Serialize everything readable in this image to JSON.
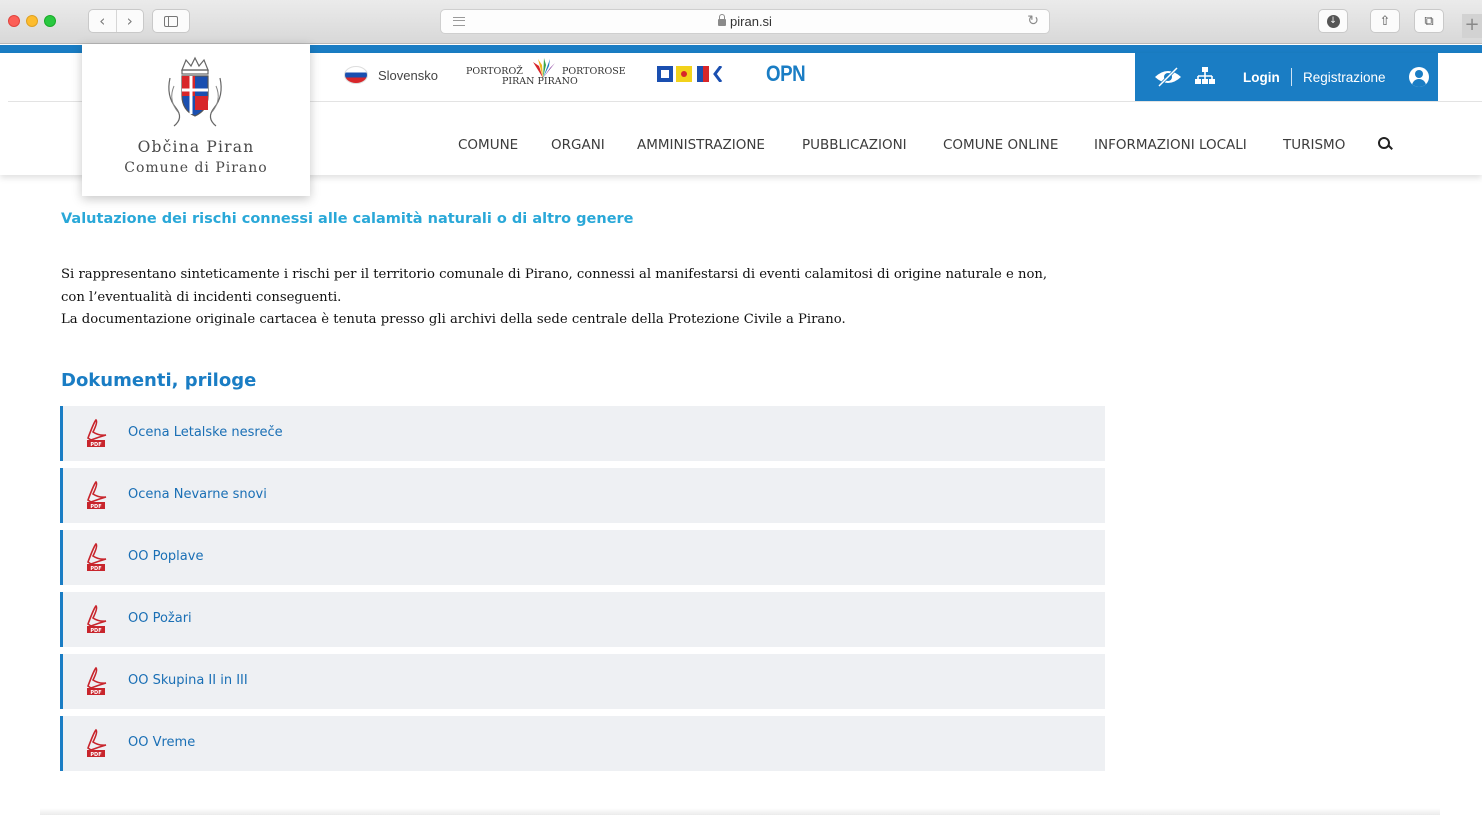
{
  "browser": {
    "url": "piran.si",
    "reader_icon": "reader-icon",
    "lock_icon": "lock-icon",
    "reload_icon": "reload-icon",
    "back_glyph": "‹",
    "forward_glyph": "›",
    "reload_glyph": "↻",
    "download_glyph": "↓",
    "share_glyph": "⇧",
    "tabs_glyph": "⧉",
    "newtab_glyph": "+"
  },
  "logo": {
    "line1": "Občina Piran",
    "line2": "Comune di Pirano"
  },
  "topbar": {
    "language": "Slovensko",
    "portoroz": {
      "left": "PORTOROŽ",
      "right": "PORTOROSE",
      "bottom": "PIRAN PIRANO"
    },
    "opn": "OPN",
    "login": "Login",
    "register": "Registrazione"
  },
  "nav": {
    "items": [
      "COMUNE",
      "ORGANI",
      "AMMINISTRAZIONE",
      "PUBBLICAZIONI",
      "COMUNE ONLINE",
      "INFORMAZIONI LOCALI",
      "TURISMO"
    ]
  },
  "content": {
    "title": "Valutazione dei rischi connessi alle calamità naturali o di altro genere",
    "intro": [
      "Si rappresentano sinteticamente i rischi per il territorio comunale di Pirano, connessi al manifestarsi di eventi calamitosi di origine naturale e non,",
      "con l’eventualità di incidenti conseguenti.",
      "La documentazione originale cartacea è tenuta presso gli archivi della sede centrale della Protezione Civile a Pirano."
    ],
    "documents_title": "Dokumenti, priloge",
    "documents": [
      {
        "label": "Ocena Letalske nesreče",
        "icon": "pdf-icon"
      },
      {
        "label": "Ocena Nevarne snovi",
        "icon": "pdf-icon"
      },
      {
        "label": "OO Poplave",
        "icon": "pdf-icon"
      },
      {
        "label": "OO Požari",
        "icon": "pdf-icon"
      },
      {
        "label": "OO Skupina II in III",
        "icon": "pdf-icon"
      },
      {
        "label": "OO Vreme",
        "icon": "pdf-icon"
      }
    ]
  },
  "colors": {
    "brand_blue": "#1a7dc4",
    "title_blue": "#2aa8d8",
    "doc_bg": "#eef0f3",
    "pdf_red": "#c8252c"
  }
}
